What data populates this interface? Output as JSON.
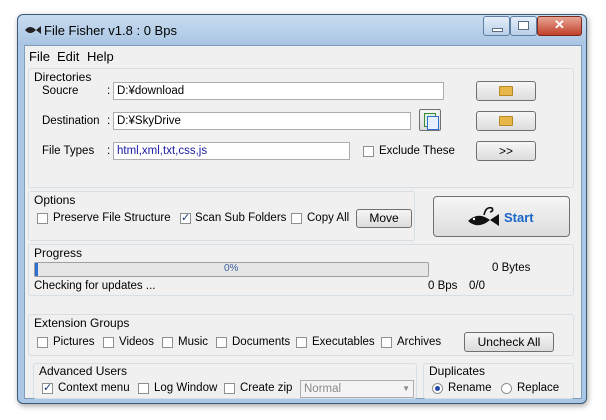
{
  "window": {
    "title": "File Fisher v1.8 : 0 Bps"
  },
  "menu": [
    "File",
    "Edit",
    "Help"
  ],
  "directories": {
    "group_label": "Directories",
    "source_label": "Soucre",
    "source_value": "D:¥download",
    "destination_label": "Destination",
    "destination_value": "D:¥SkyDrive",
    "filetypes_label": "File Types",
    "filetypes_value": "html,xml,txt,css,js",
    "exclude_label": "Exclude These",
    "exclude_checked": false,
    "more_button": ">>"
  },
  "options": {
    "group_label": "Options",
    "preserve_label": "Preserve File Structure",
    "preserve_checked": false,
    "scan_label": "Scan Sub Folders",
    "scan_checked": true,
    "copy_label": "Copy All",
    "copy_checked": false,
    "move_button": "Move"
  },
  "start_button": "Start",
  "progress": {
    "group_label": "Progress",
    "percent_text": "0%",
    "value": 0.0,
    "bytes_text": "0 Bytes",
    "status_text": "Checking for updates ...",
    "speed_text": "0 Bps",
    "count_text": "0/0"
  },
  "extension_groups": {
    "group_label": "Extension Groups",
    "items": [
      {
        "label": "Pictures",
        "checked": false
      },
      {
        "label": "Videos",
        "checked": false
      },
      {
        "label": "Music",
        "checked": false
      },
      {
        "label": "Documents",
        "checked": false
      },
      {
        "label": "Executables",
        "checked": false
      },
      {
        "label": "Archives",
        "checked": false
      }
    ],
    "uncheck_button": "Uncheck All"
  },
  "advanced": {
    "group_label": "Advanced Users",
    "context_label": "Context menu",
    "context_checked": true,
    "log_label": "Log Window",
    "log_checked": false,
    "zip_label": "Create zip",
    "zip_checked": false,
    "zip_select_value": "Normal"
  },
  "duplicates": {
    "group_label": "Duplicates",
    "rename_label": "Rename",
    "rename_selected": true,
    "replace_label": "Replace",
    "replace_selected": false
  },
  "colors": {
    "accent_blue": "#1a66c8",
    "filetypes_text": "#1a1aa8",
    "progress_fill": "#2f6fd0"
  }
}
